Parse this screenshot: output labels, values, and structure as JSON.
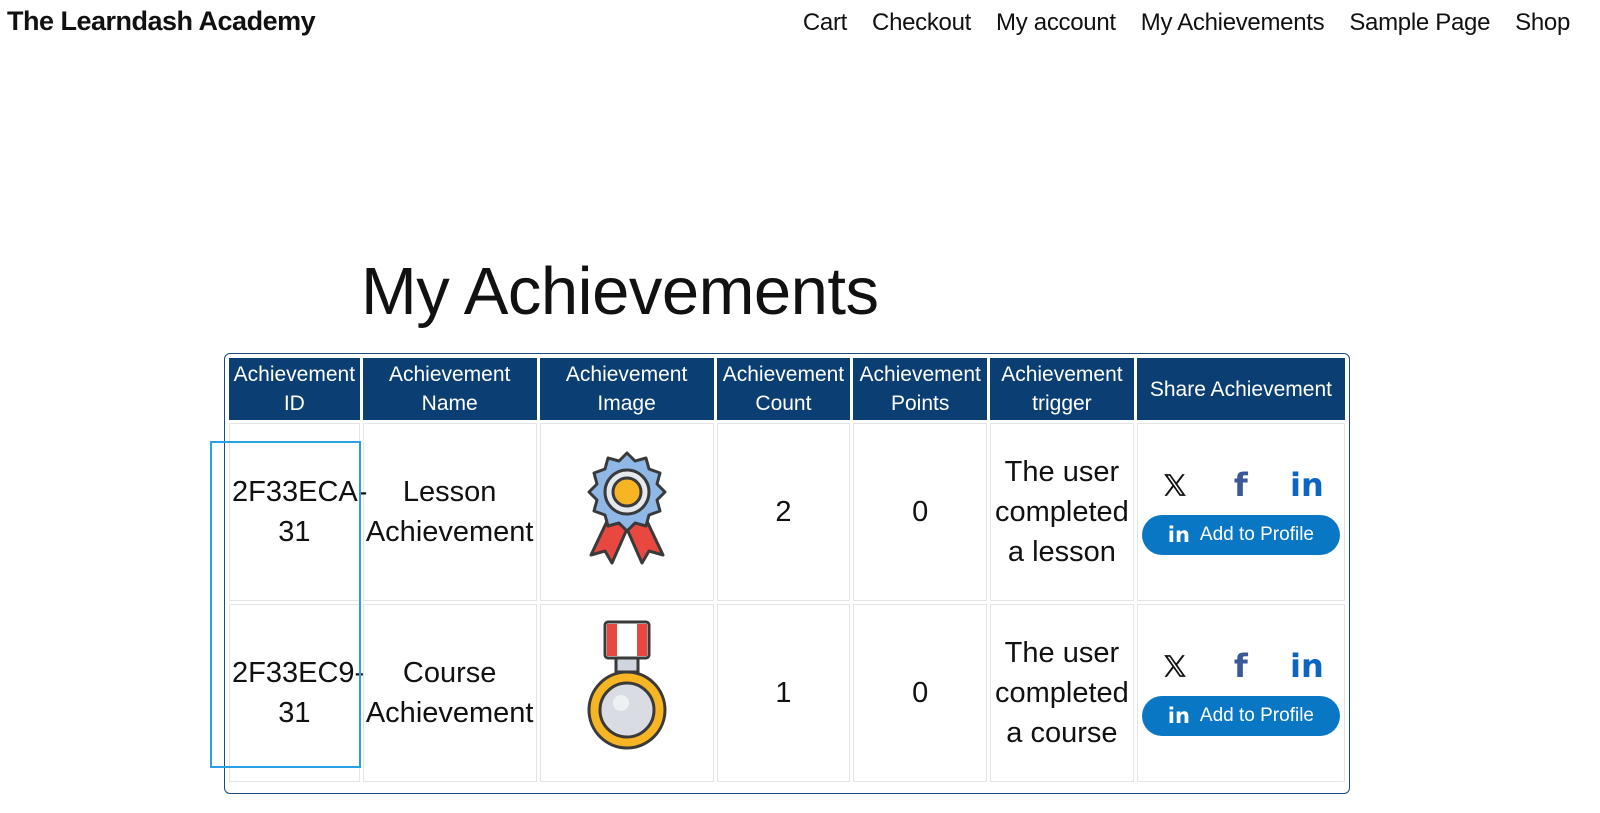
{
  "site": {
    "title": "The Learndash Academy"
  },
  "nav": {
    "items": [
      "Cart",
      "Checkout",
      "My account",
      "My Achievements",
      "Sample Page",
      "Shop"
    ]
  },
  "page": {
    "title": "My Achievements"
  },
  "table": {
    "headers": [
      "Achievement ID",
      "Achievement Name",
      "Achievement Image",
      "Achievement Count",
      "Achievement Points",
      "Achievement trigger",
      "Share Achievement"
    ],
    "rows": [
      {
        "id": "2F33ECA-31",
        "name": "Lesson Achievement",
        "image_icon": "ribbon-award-icon",
        "count": "2",
        "points": "0",
        "trigger": "The user completed a lesson",
        "share_button": "Add to Profile"
      },
      {
        "id": "2F33EC9-31",
        "name": "Course Achievement",
        "image_icon": "medal-icon",
        "count": "1",
        "points": "0",
        "trigger": "The user completed a course",
        "share_button": "Add to Profile"
      }
    ]
  },
  "colors": {
    "header_bg": "#0b3f73",
    "linkedin": "#0a77c5",
    "facebook": "#3b5998",
    "highlight": "#2aa0e6"
  }
}
